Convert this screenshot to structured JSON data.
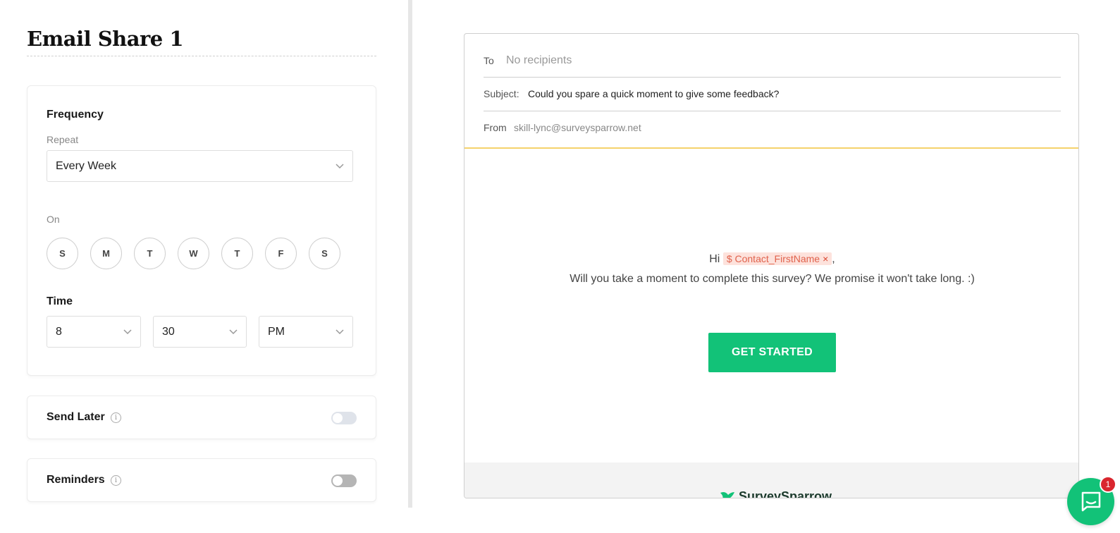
{
  "page": {
    "title": "Email Share 1"
  },
  "frequency": {
    "heading": "Frequency",
    "repeat_label": "Repeat",
    "repeat_value": "Every Week",
    "on_label": "On",
    "days": [
      "S",
      "M",
      "T",
      "W",
      "T",
      "F",
      "S"
    ]
  },
  "time": {
    "heading": "Time",
    "hour": "8",
    "minute": "30",
    "meridiem": "PM"
  },
  "send_later": {
    "label": "Send Later",
    "enabled": false
  },
  "reminders": {
    "label": "Reminders",
    "enabled": false
  },
  "email": {
    "to_label": "To",
    "to_placeholder": "No recipients",
    "subject_label": "Subject:",
    "subject_value": "Could you spare a quick moment to give some feedback?",
    "from_label": "From",
    "from_value": "skill-lync@surveysparrow.net",
    "greeting": "Hi",
    "token_prefix": "$",
    "token": "Contact_FirstName",
    "token_remove": "×",
    "greeting_suffix": ",",
    "body": "Will you take a moment to complete this survey? We promise it won't take long. :)",
    "cta": "GET STARTED",
    "footer_brand": "SurveySparrow"
  },
  "chat": {
    "badge_count": "1"
  },
  "colors": {
    "accent_green": "#12c278",
    "divider_yellow": "#f5d26b",
    "token_bg": "#fde2dc",
    "token_text": "#e0624c",
    "badge_red": "#d9262e"
  },
  "icons": {
    "chevron": "chevron-down-icon",
    "info": "info-icon",
    "chat": "chat-icon",
    "logo": "surveysparrow-logo-icon"
  }
}
